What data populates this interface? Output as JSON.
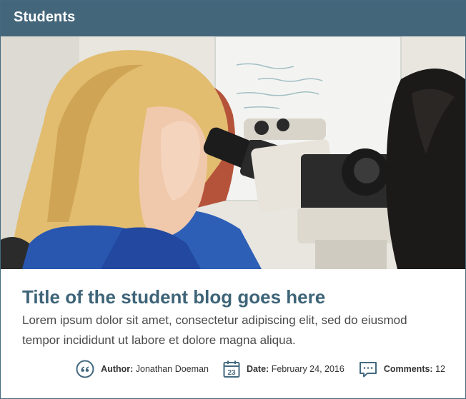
{
  "header": {
    "title": "Students"
  },
  "post": {
    "title": "Title of the student blog goes here",
    "excerpt": "Lorem ipsum dolor sit amet, consectetur adipiscing elit, sed do eiusmod tempor incididunt ut labore et dolore magna aliqua."
  },
  "meta": {
    "author_label": "Author:",
    "author": "Jonathan Doeman",
    "date_label": "Date:",
    "date": "February 24, 2016",
    "calendar_day": "23",
    "comments_label": "Comments:",
    "comments": "12"
  },
  "icons": [
    "quote-icon",
    "calendar-icon",
    "comment-icon"
  ],
  "colors": {
    "header_bg": "#44667b",
    "title": "#3e6478",
    "icon": "#446a80"
  }
}
